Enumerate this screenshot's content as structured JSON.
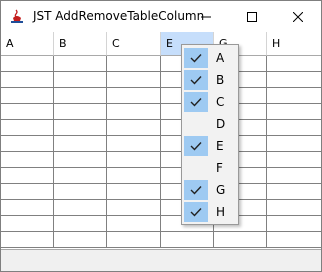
{
  "window": {
    "title": "JST AddRemoveTableColumn"
  },
  "columns": [
    {
      "label": "A",
      "selected": false
    },
    {
      "label": "B",
      "selected": false
    },
    {
      "label": "C",
      "selected": false
    },
    {
      "label": "E",
      "selected": true
    },
    {
      "label": "G",
      "selected": false
    },
    {
      "label": "H",
      "selected": false
    }
  ],
  "row_count": 12,
  "menu": {
    "items": [
      {
        "label": "A",
        "checked": true
      },
      {
        "label": "B",
        "checked": true
      },
      {
        "label": "C",
        "checked": true
      },
      {
        "label": "D",
        "checked": false
      },
      {
        "label": "E",
        "checked": true
      },
      {
        "label": "F",
        "checked": false
      },
      {
        "label": "G",
        "checked": true
      },
      {
        "label": "H",
        "checked": true
      }
    ]
  },
  "colors": {
    "selected_header": "#c6defb",
    "menu_check_bg": "#9ecaf2",
    "grid_line": "#808080"
  }
}
